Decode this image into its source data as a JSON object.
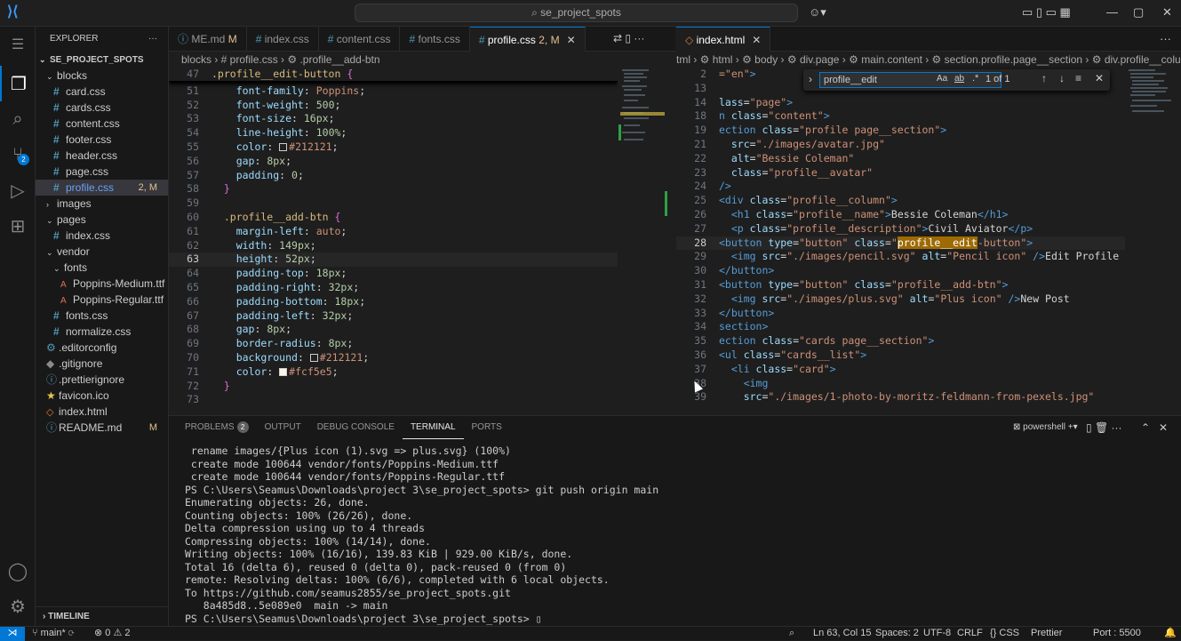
{
  "titlebar": {
    "search": "se_project_spots"
  },
  "activity": [
    {
      "name": "explorer-icon",
      "glyph": "❐",
      "active": true
    },
    {
      "name": "search-icon",
      "glyph": "⌕",
      "active": false
    },
    {
      "name": "source-control-icon",
      "glyph": "⑂",
      "active": false,
      "badge": "2"
    },
    {
      "name": "run-debug-icon",
      "glyph": "▷",
      "active": false
    },
    {
      "name": "extensions-icon",
      "glyph": "⊞",
      "active": false
    }
  ],
  "sidebar": {
    "title": "EXPLORER",
    "project": "SE_PROJECT_SPOTS",
    "timeline": "TIMELINE",
    "items": [
      {
        "label": "blocks",
        "kind": "folder",
        "indent": 1,
        "open": true
      },
      {
        "label": "card.css",
        "kind": "css",
        "indent": 2
      },
      {
        "label": "cards.css",
        "kind": "css",
        "indent": 2
      },
      {
        "label": "content.css",
        "kind": "css",
        "indent": 2
      },
      {
        "label": "footer.css",
        "kind": "css",
        "indent": 2
      },
      {
        "label": "header.css",
        "kind": "css",
        "indent": 2
      },
      {
        "label": "page.css",
        "kind": "css",
        "indent": 2
      },
      {
        "label": "profile.css",
        "kind": "css",
        "indent": 2,
        "selected": true,
        "mark": "2, M"
      },
      {
        "label": "images",
        "kind": "folder",
        "indent": 1,
        "open": false
      },
      {
        "label": "pages",
        "kind": "folder",
        "indent": 1,
        "open": true
      },
      {
        "label": "index.css",
        "kind": "css",
        "indent": 2
      },
      {
        "label": "vendor",
        "kind": "folder",
        "indent": 1,
        "open": true
      },
      {
        "label": "fonts",
        "kind": "folder",
        "indent": 2,
        "open": true
      },
      {
        "label": "Poppins-Medium.ttf",
        "kind": "font",
        "indent": 3
      },
      {
        "label": "Poppins-Regular.ttf",
        "kind": "font",
        "indent": 3
      },
      {
        "label": "fonts.css",
        "kind": "css",
        "indent": 2
      },
      {
        "label": "normalize.css",
        "kind": "css",
        "indent": 2
      },
      {
        "label": ".editorconfig",
        "kind": "gear",
        "indent": 1
      },
      {
        "label": ".gitignore",
        "kind": "git",
        "indent": 1
      },
      {
        "label": ".prettierignore",
        "kind": "info",
        "indent": 1
      },
      {
        "label": "favicon.ico",
        "kind": "star",
        "indent": 1
      },
      {
        "label": "index.html",
        "kind": "html",
        "indent": 1
      },
      {
        "label": "README.md",
        "kind": "info",
        "indent": 1,
        "mark": "M"
      }
    ]
  },
  "tabs_left": [
    {
      "label": "ME.md",
      "mark": "M",
      "icon": "info"
    },
    {
      "label": "index.css",
      "icon": "css"
    },
    {
      "label": "content.css",
      "icon": "css"
    },
    {
      "label": "fonts.css",
      "icon": "css"
    },
    {
      "label": "profile.css",
      "mark": "2, M",
      "icon": "css",
      "active": true
    }
  ],
  "tabs_right": [
    {
      "label": "index.html",
      "icon": "html",
      "active": true
    }
  ],
  "breadcrumb_left": "blocks  ›  # profile.css  ›  ⚙ .profile__add-btn",
  "breadcrumb_right": "tml  ›  ⚙ html  ›  ⚙ body  ›  ⚙ div.page  ›  ⚙ main.content  ›  ⚙ section.profile.page__section  ›  ⚙ div.profile__column",
  "left_lines": [
    {
      "n": "47",
      "t": [
        [
          "sel-k",
          ".profile__edit-button "
        ],
        [
          "br",
          "{"
        ]
      ],
      "sticky": true
    },
    {
      "n": "51",
      "t": [
        [
          "prop",
          "    font-family"
        ],
        [
          "txt",
          ": "
        ],
        [
          "val",
          "Poppins"
        ],
        [
          "txt",
          ";"
        ]
      ]
    },
    {
      "n": "52",
      "t": [
        [
          "prop",
          "    font-weight"
        ],
        [
          "txt",
          ": "
        ],
        [
          "num",
          "500"
        ],
        [
          "txt",
          ";"
        ]
      ]
    },
    {
      "n": "53",
      "t": [
        [
          "prop",
          "    font-size"
        ],
        [
          "txt",
          ": "
        ],
        [
          "num",
          "16px"
        ],
        [
          "txt",
          ";"
        ]
      ]
    },
    {
      "n": "54",
      "t": [
        [
          "prop",
          "    line-height"
        ],
        [
          "txt",
          ": "
        ],
        [
          "num",
          "100%"
        ],
        [
          "txt",
          ";"
        ]
      ]
    },
    {
      "n": "55",
      "t": [
        [
          "prop",
          "    color"
        ],
        [
          "txt",
          ": "
        ],
        [
          "sw",
          "#212121"
        ],
        [
          "val",
          "#212121"
        ],
        [
          "txt",
          ";"
        ]
      ]
    },
    {
      "n": "56",
      "t": [
        [
          "prop",
          "    gap"
        ],
        [
          "txt",
          ": "
        ],
        [
          "num",
          "8px"
        ],
        [
          "txt",
          ";"
        ]
      ]
    },
    {
      "n": "57",
      "t": [
        [
          "prop",
          "    padding"
        ],
        [
          "txt",
          ": "
        ],
        [
          "num",
          "0"
        ],
        [
          "txt",
          ";"
        ]
      ]
    },
    {
      "n": "58",
      "t": [
        [
          "br",
          "  }"
        ]
      ]
    },
    {
      "n": "59",
      "t": []
    },
    {
      "n": "60",
      "t": [
        [
          "sel-k",
          "  .profile__add-btn "
        ],
        [
          "br",
          "{"
        ]
      ]
    },
    {
      "n": "61",
      "t": [
        [
          "prop",
          "    margin-left"
        ],
        [
          "txt",
          ": "
        ],
        [
          "val",
          "auto"
        ],
        [
          "txt",
          ";"
        ]
      ]
    },
    {
      "n": "62",
      "t": [
        [
          "prop",
          "    width"
        ],
        [
          "txt",
          ": "
        ],
        [
          "num",
          "149px"
        ],
        [
          "txt",
          ";"
        ]
      ]
    },
    {
      "n": "63",
      "t": [
        [
          "prop",
          "    height"
        ],
        [
          "txt",
          ": "
        ],
        [
          "num",
          "52px"
        ],
        [
          "txt",
          ";"
        ]
      ],
      "cur": true
    },
    {
      "n": "64",
      "t": [
        [
          "prop",
          "    padding-top"
        ],
        [
          "txt",
          ": "
        ],
        [
          "num",
          "18px"
        ],
        [
          "txt",
          ";"
        ]
      ]
    },
    {
      "n": "65",
      "t": [
        [
          "prop",
          "    padding-right"
        ],
        [
          "txt",
          ": "
        ],
        [
          "num",
          "32px"
        ],
        [
          "txt",
          ";"
        ]
      ]
    },
    {
      "n": "66",
      "t": [
        [
          "prop",
          "    padding-bottom"
        ],
        [
          "txt",
          ": "
        ],
        [
          "num",
          "18px"
        ],
        [
          "txt",
          ";"
        ]
      ]
    },
    {
      "n": "67",
      "t": [
        [
          "prop",
          "    padding-left"
        ],
        [
          "txt",
          ": "
        ],
        [
          "num",
          "32px"
        ],
        [
          "txt",
          ";"
        ]
      ]
    },
    {
      "n": "68",
      "t": [
        [
          "prop",
          "    gap"
        ],
        [
          "txt",
          ": "
        ],
        [
          "num",
          "8px"
        ],
        [
          "txt",
          ";"
        ]
      ]
    },
    {
      "n": "69",
      "t": [
        [
          "prop",
          "    border-radius"
        ],
        [
          "txt",
          ": "
        ],
        [
          "num",
          "8px"
        ],
        [
          "txt",
          ";"
        ]
      ]
    },
    {
      "n": "70",
      "t": [
        [
          "prop",
          "    background"
        ],
        [
          "txt",
          ": "
        ],
        [
          "sw",
          "#212121"
        ],
        [
          "val",
          "#212121"
        ],
        [
          "txt",
          ";"
        ]
      ]
    },
    {
      "n": "71",
      "t": [
        [
          "prop",
          "    color"
        ],
        [
          "txt",
          ": "
        ],
        [
          "sw",
          "#fcf5e5"
        ],
        [
          "val",
          "#fcf5e5"
        ],
        [
          "txt",
          ";"
        ]
      ]
    },
    {
      "n": "72",
      "t": [
        [
          "br",
          "  }"
        ]
      ]
    },
    {
      "n": "73",
      "t": []
    }
  ],
  "right_lines": [
    {
      "n": "2",
      "t": [
        [
          "str",
          "=\"en\""
        ],
        [
          "tag",
          ">"
        ]
      ]
    },
    {
      "n": "13",
      "t": []
    },
    {
      "n": "14",
      "t": [
        [
          "attr",
          "lass"
        ],
        [
          "txt",
          "="
        ],
        [
          "str",
          "\"page\""
        ],
        [
          "tag",
          ">"
        ]
      ]
    },
    {
      "n": "18",
      "t": [
        [
          "tag",
          "n "
        ],
        [
          "attr",
          "class"
        ],
        [
          "txt",
          "="
        ],
        [
          "str",
          "\"content\""
        ],
        [
          "tag",
          ">"
        ]
      ]
    },
    {
      "n": "19",
      "t": [
        [
          "tag",
          "ection "
        ],
        [
          "attr",
          "class"
        ],
        [
          "txt",
          "="
        ],
        [
          "str",
          "\"profile page__section\""
        ],
        [
          "tag",
          ">"
        ]
      ]
    },
    {
      "n": "21",
      "t": [
        [
          "attr",
          "  src"
        ],
        [
          "txt",
          "="
        ],
        [
          "str",
          "\"./images/avatar.jpg\""
        ]
      ]
    },
    {
      "n": "22",
      "t": [
        [
          "attr",
          "  alt"
        ],
        [
          "txt",
          "="
        ],
        [
          "str",
          "\"Bessie Coleman\""
        ]
      ]
    },
    {
      "n": "23",
      "t": [
        [
          "attr",
          "  class"
        ],
        [
          "txt",
          "="
        ],
        [
          "str",
          "\"profile__avatar\""
        ]
      ]
    },
    {
      "n": "24",
      "t": [
        [
          "tag",
          "/>"
        ]
      ]
    },
    {
      "n": "25",
      "t": [
        [
          "tag",
          "<div "
        ],
        [
          "attr",
          "class"
        ],
        [
          "txt",
          "="
        ],
        [
          "str",
          "\"profile__column\""
        ],
        [
          "tag",
          ">"
        ]
      ]
    },
    {
      "n": "26",
      "t": [
        [
          "tag",
          "  <h1 "
        ],
        [
          "attr",
          "class"
        ],
        [
          "txt",
          "="
        ],
        [
          "str",
          "\"profile__name\""
        ],
        [
          "tag",
          ">"
        ],
        [
          "txt",
          "Bessie Coleman"
        ],
        [
          "tag",
          "</h1>"
        ]
      ]
    },
    {
      "n": "27",
      "t": [
        [
          "tag",
          "  <p "
        ],
        [
          "attr",
          "class"
        ],
        [
          "txt",
          "="
        ],
        [
          "str",
          "\"profile__description\""
        ],
        [
          "tag",
          ">"
        ],
        [
          "txt",
          "Civil Aviator"
        ],
        [
          "tag",
          "</p>"
        ]
      ]
    },
    {
      "n": "28",
      "t": [
        [
          "tag",
          "<button "
        ],
        [
          "attr",
          "type"
        ],
        [
          "txt",
          "="
        ],
        [
          "str",
          "\"button\" "
        ],
        [
          "attr",
          "class"
        ],
        [
          "txt",
          "="
        ],
        [
          "str",
          "\""
        ],
        [
          "hl",
          "profile__edit"
        ],
        [
          "str",
          "-button\""
        ],
        [
          "tag",
          ">"
        ]
      ],
      "cur": true
    },
    {
      "n": "29",
      "t": [
        [
          "tag",
          "  <img "
        ],
        [
          "attr",
          "src"
        ],
        [
          "txt",
          "="
        ],
        [
          "str",
          "\"./images/pencil.svg\" "
        ],
        [
          "attr",
          "alt"
        ],
        [
          "txt",
          "="
        ],
        [
          "str",
          "\"Pencil icon\" "
        ],
        [
          "tag",
          "/>"
        ],
        [
          "txt",
          "Edit Profile"
        ]
      ]
    },
    {
      "n": "30",
      "t": [
        [
          "tag",
          "</button>"
        ]
      ]
    },
    {
      "n": "31",
      "t": [
        [
          "tag",
          "<button "
        ],
        [
          "attr",
          "type"
        ],
        [
          "txt",
          "="
        ],
        [
          "str",
          "\"button\" "
        ],
        [
          "attr",
          "class"
        ],
        [
          "txt",
          "="
        ],
        [
          "str",
          "\"profile__add-btn\""
        ],
        [
          "tag",
          ">"
        ]
      ]
    },
    {
      "n": "32",
      "t": [
        [
          "tag",
          "  <img "
        ],
        [
          "attr",
          "src"
        ],
        [
          "txt",
          "="
        ],
        [
          "str",
          "\"./images/plus.svg\" "
        ],
        [
          "attr",
          "alt"
        ],
        [
          "txt",
          "="
        ],
        [
          "str",
          "\"Plus icon\" "
        ],
        [
          "tag",
          "/>"
        ],
        [
          "txt",
          "New Post"
        ]
      ]
    },
    {
      "n": "33",
      "t": [
        [
          "tag",
          "</button>"
        ]
      ]
    },
    {
      "n": "34",
      "t": [
        [
          "tag",
          "section>"
        ]
      ]
    },
    {
      "n": "35",
      "t": [
        [
          "tag",
          "ection "
        ],
        [
          "attr",
          "class"
        ],
        [
          "txt",
          "="
        ],
        [
          "str",
          "\"cards page__section\""
        ],
        [
          "tag",
          ">"
        ]
      ]
    },
    {
      "n": "36",
      "t": [
        [
          "tag",
          "<ul "
        ],
        [
          "attr",
          "class"
        ],
        [
          "txt",
          "="
        ],
        [
          "str",
          "\"cards__list\""
        ],
        [
          "tag",
          ">"
        ]
      ]
    },
    {
      "n": "37",
      "t": [
        [
          "tag",
          "  <li "
        ],
        [
          "attr",
          "class"
        ],
        [
          "txt",
          "="
        ],
        [
          "str",
          "\"card\""
        ],
        [
          "tag",
          ">"
        ]
      ]
    },
    {
      "n": "38",
      "t": [
        [
          "tag",
          "    <img"
        ]
      ]
    },
    {
      "n": "39",
      "t": [
        [
          "attr",
          "    src"
        ],
        [
          "txt",
          "="
        ],
        [
          "str",
          "\"./images/1-photo-by-moritz-feldmann-from-pexels.jpg\""
        ]
      ]
    }
  ],
  "find": {
    "query": "profile__edit",
    "count": "1 of 1",
    "aa": "Aa",
    "ab": "ab",
    "rx": ".*"
  },
  "panel": {
    "tabs": [
      {
        "label": "PROBLEMS",
        "badge": "2"
      },
      {
        "label": "OUTPUT"
      },
      {
        "label": "DEBUG CONSOLE"
      },
      {
        "label": "TERMINAL",
        "active": true
      },
      {
        "label": "PORTS"
      }
    ],
    "shell": "powershell",
    "lines": [
      " rename images/{Plus icon (1).svg => plus.svg} (100%)",
      " create mode 100644 vendor/fonts/Poppins-Medium.ttf",
      " create mode 100644 vendor/fonts/Poppins-Regular.ttf",
      "PS C:\\Users\\Seamus\\Downloads\\project 3\\se_project_spots> git push origin main",
      "Enumerating objects: 26, done.",
      "Counting objects: 100% (26/26), done.",
      "Delta compression using up to 4 threads",
      "Compressing objects: 100% (14/14), done.",
      "Writing objects: 100% (16/16), 139.83 KiB | 929.00 KiB/s, done.",
      "Total 16 (delta 6), reused 0 (delta 0), pack-reused 0 (from 0)",
      "remote: Resolving deltas: 100% (6/6), completed with 6 local objects.",
      "To https://github.com/seamus2855/se_project_spots.git",
      "   8a485d8..5e089e0  main -> main",
      "PS C:\\Users\\Seamus\\Downloads\\project 3\\se_project_spots> ▯"
    ]
  },
  "status": {
    "branch": "main*",
    "problems": "⊗ 0 ⚠ 2",
    "position": "Ln 63, Col 15",
    "spaces": "Spaces: 2",
    "encoding": "UTF-8",
    "eol": "CRLF",
    "lang": "{} CSS",
    "prettier": "Prettier",
    "port": "Port : 5500"
  }
}
